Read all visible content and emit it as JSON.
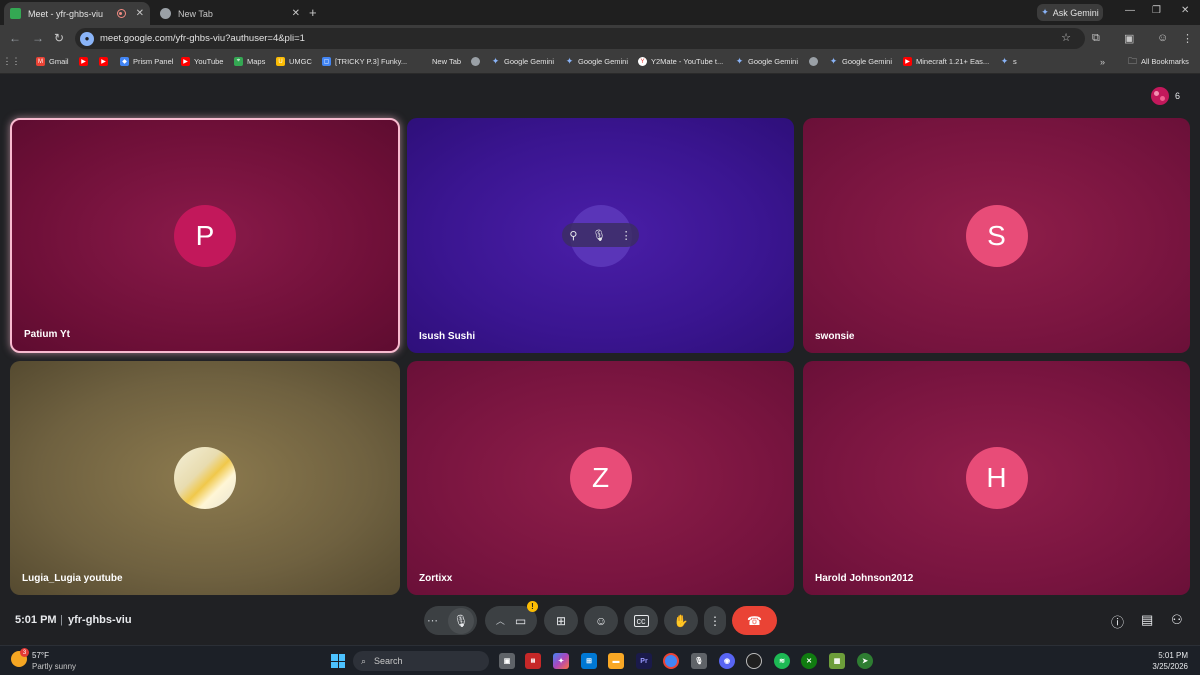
{
  "browser": {
    "tabs": [
      {
        "title": "Meet - yfr-ghbs-viu",
        "active": true
      },
      {
        "title": "New Tab",
        "active": false
      }
    ],
    "ask_gemini": "Ask Gemini",
    "url": "meet.google.com/yfr-ghbs-viu?authuser=4&pli=1",
    "bookmarks": [
      {
        "label": "",
        "icon": "apps-grid-icon"
      },
      {
        "label": "Gmail",
        "icon": "gmail-icon"
      },
      {
        "label": "",
        "icon": "youtube-icon"
      },
      {
        "label": "",
        "icon": "youtube-icon"
      },
      {
        "label": "Prism Panel",
        "icon": "prism-icon"
      },
      {
        "label": "YouTube",
        "icon": "youtube-icon"
      },
      {
        "label": "Maps",
        "icon": "maps-icon"
      },
      {
        "label": "UMGC",
        "icon": "umgc-icon"
      },
      {
        "label": "[TRICKY P.3] Funky...",
        "icon": "bookmark-icon"
      },
      {
        "label": "New Tab",
        "icon": ""
      },
      {
        "label": "",
        "icon": "globe-icon"
      },
      {
        "label": "Google Gemini",
        "icon": "gemini-icon"
      },
      {
        "label": "Google Gemini",
        "icon": "gemini-icon"
      },
      {
        "label": "Y2Mate - YouTube t...",
        "icon": "y2mate-icon"
      },
      {
        "label": "Google Gemini",
        "icon": "gemini-icon"
      },
      {
        "label": "",
        "icon": "globe-icon"
      },
      {
        "label": "Google Gemini",
        "icon": "gemini-icon"
      },
      {
        "label": "Minecraft 1.21+ Eas...",
        "icon": "youtube-icon"
      },
      {
        "label": "s",
        "icon": "gemini-icon"
      }
    ],
    "all_bookmarks": "All Bookmarks"
  },
  "meet": {
    "participant_count": "6",
    "tiles": [
      {
        "name": "Patium Yt",
        "initial": "P"
      },
      {
        "name": "Isush Sushi",
        "initial": ""
      },
      {
        "name": "swonsie",
        "initial": "S"
      },
      {
        "name": "Lugia_Lugia youtube",
        "initial": ""
      },
      {
        "name": "Zortixx",
        "initial": "Z"
      },
      {
        "name": "Harold Johnson2012",
        "initial": "H"
      }
    ],
    "time": "5:01 PM",
    "separator": "|",
    "meeting_code": "yfr-ghbs-viu",
    "camera_warning": "!"
  },
  "taskbar": {
    "temperature": "57°F",
    "condition": "Partly sunny",
    "weather_badge": "3",
    "search_label": "Search",
    "clock_time": "5:01 PM",
    "clock_date": "3/25/2026",
    "apps": [
      "file-explorer-icon",
      "news-icon",
      "copilot-icon",
      "store-icon",
      "folder-icon",
      "premiere-icon",
      "chrome-icon",
      "mic-app-icon",
      "discord-icon",
      "obs-icon",
      "spotify-icon",
      "xbox-icon",
      "minecraft-icon",
      "app-icon"
    ]
  },
  "colors": {
    "accent_pink": "#f8bbd0",
    "leave_red": "#ea4335",
    "meet_bg": "#202124"
  }
}
